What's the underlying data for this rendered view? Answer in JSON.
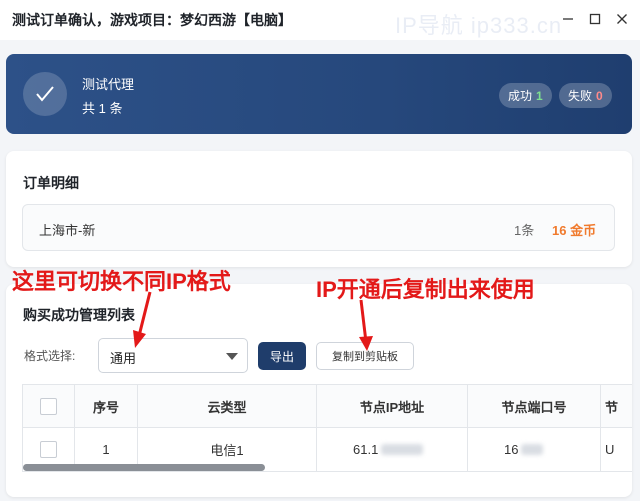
{
  "window": {
    "title": "测试订单确认，游戏项目：梦幻西游【电脑】"
  },
  "watermark": "IP导航 ip333.cn",
  "summary": {
    "title": "测试代理",
    "count": "共 1 条",
    "success_label": "成功",
    "success_count": "1",
    "fail_label": "失败",
    "fail_count": "0"
  },
  "order": {
    "title": "订单明细",
    "location": "上海市-新",
    "quantity": "1条",
    "price": "16 金币"
  },
  "annotations": {
    "left": "这里可切换不同IP格式",
    "right": "IP开通后复制出来使用"
  },
  "list": {
    "title": "购买成功管理列表",
    "format_label": "格式选择:",
    "format_value": "通用",
    "export_label": "导出",
    "copy_label": "复制到剪贴板",
    "columns": [
      "序号",
      "云类型",
      "节点IP地址",
      "节点端口号",
      "节"
    ],
    "rows": [
      {
        "index": "1",
        "cloud_type": "电信1",
        "ip": "61.1",
        "port": "16",
        "extra": "U"
      }
    ]
  },
  "colors": {
    "header_bg": "#26487c",
    "accent_orange": "#f07a2d",
    "annotation_red": "#e31919",
    "button_dark": "#1f3d6b"
  }
}
